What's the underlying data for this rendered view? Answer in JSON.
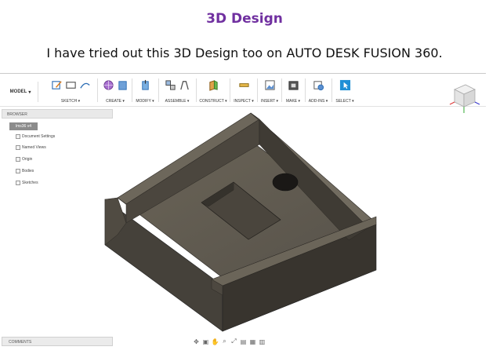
{
  "slide": {
    "title": "3D Design",
    "subtitle": "I have tried out this 3D Design too on AUTO DESK FUSION 360."
  },
  "toolbar": {
    "workspace": "MODEL",
    "groups": [
      {
        "label": "SKETCH ▾"
      },
      {
        "label": "CREATE ▾"
      },
      {
        "label": "MODIFY ▾"
      },
      {
        "label": "ASSEMBLE ▾"
      },
      {
        "label": "CONSTRUCT ▾"
      },
      {
        "label": "INSPECT ▾"
      },
      {
        "label": "INSERT ▾"
      },
      {
        "label": "MAKE ▾"
      },
      {
        "label": "ADD-INS ▾"
      },
      {
        "label": "SELECT ▾"
      }
    ]
  },
  "browser": {
    "header": "BROWSER",
    "root": "lms36 v4",
    "items": [
      "Document Settings",
      "Named Views",
      "Origin",
      "Bodies",
      "Sketches"
    ]
  },
  "comments": "COMMENTS",
  "navbar": {
    "icons": [
      "orbit-icon",
      "look-at-icon",
      "pan-icon",
      "zoom-icon",
      "fit-icon",
      "display-settings-icon",
      "grid-settings-icon",
      "viewports-icon"
    ]
  },
  "colors": {
    "title": "#7030a0",
    "model_top": "#5f5a4f",
    "model_left": "#4a453c",
    "model_front": "#3a3630",
    "select_blue": "#1f8fd6"
  }
}
